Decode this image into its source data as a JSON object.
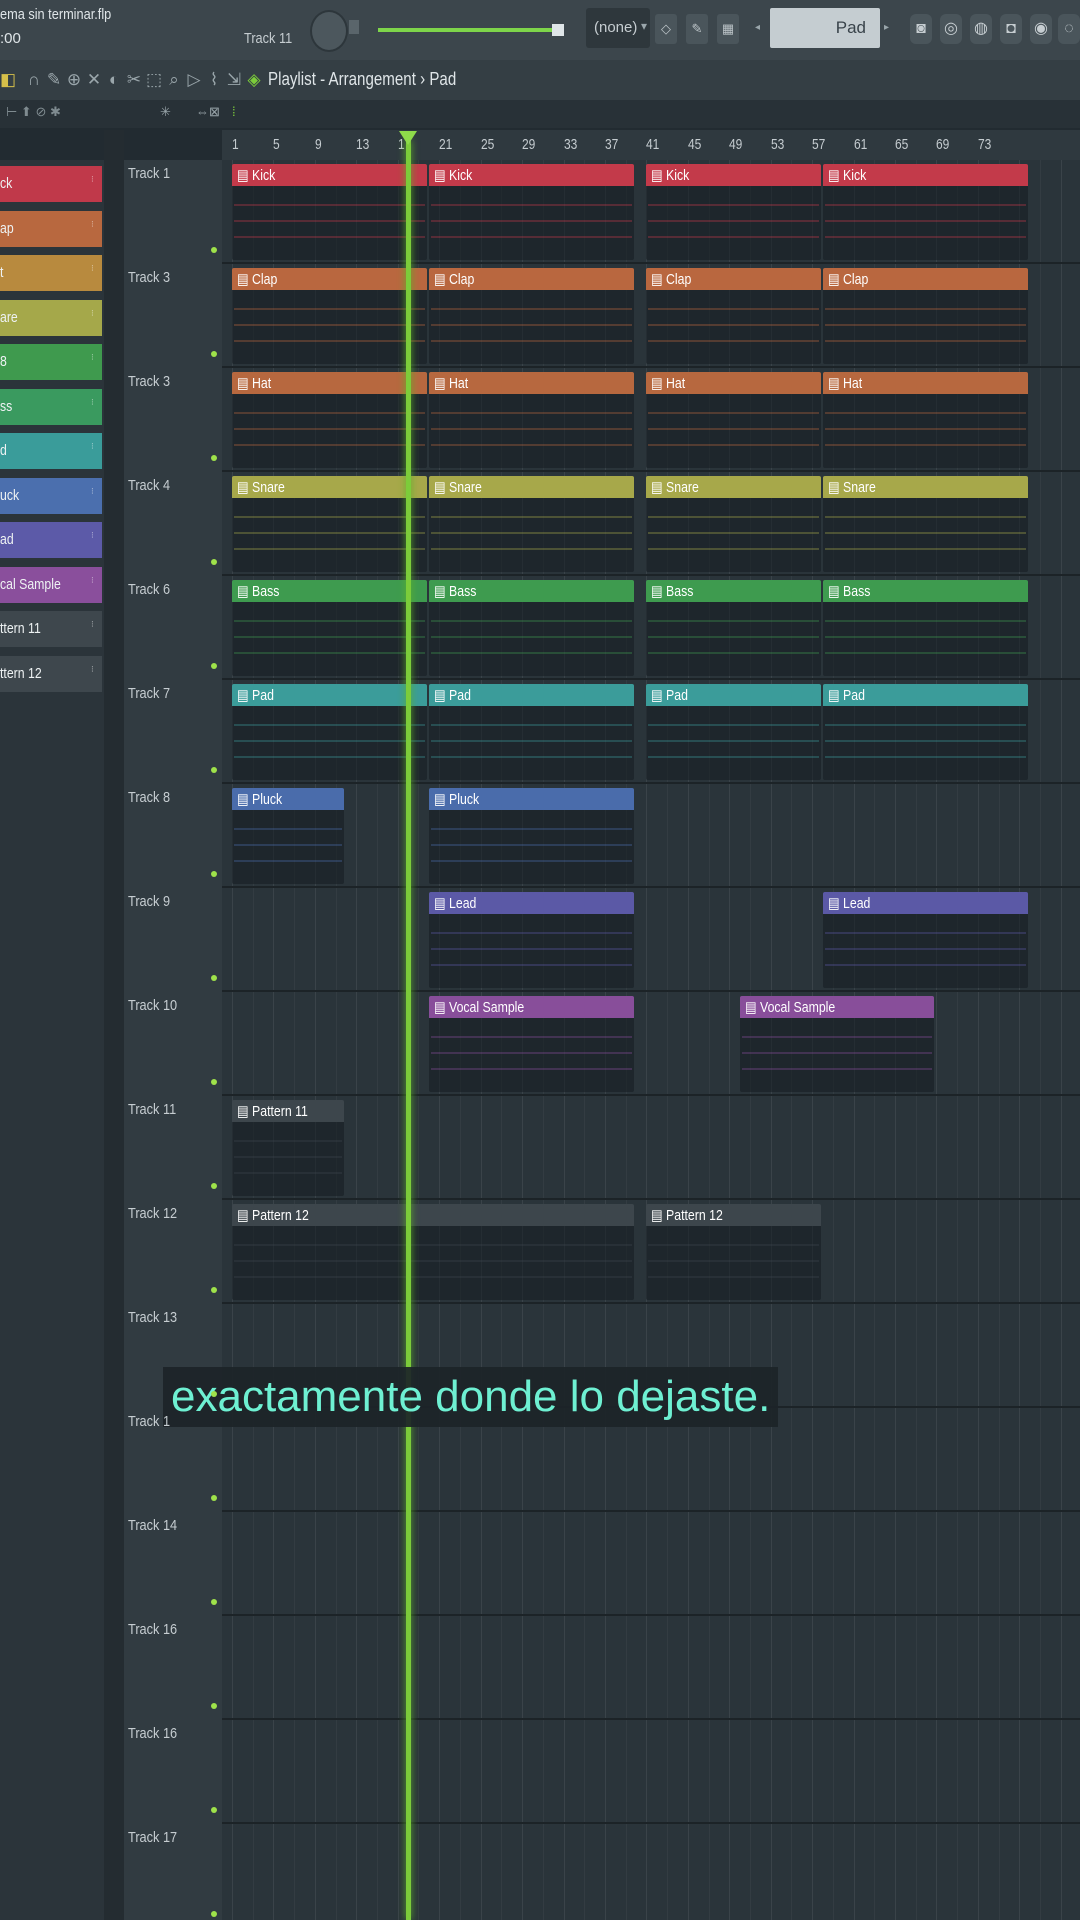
{
  "project": {
    "filename": "ema sin terminar.flp",
    "time": ":00"
  },
  "top_bar": {
    "track_selector": "Track 11",
    "pattern_selector": "(none)",
    "channel_display": "Pad"
  },
  "window": {
    "title": "Playlist - Arrangement › Pad"
  },
  "ruler": {
    "bars": [
      "1",
      "5",
      "9",
      "13",
      "17",
      "21",
      "25",
      "29",
      "33",
      "37",
      "41",
      "45",
      "49",
      "53",
      "57",
      "61",
      "65",
      "69",
      "73"
    ]
  },
  "pattern_list": [
    {
      "label": "ck",
      "color": "#c0394a"
    },
    {
      "label": "ap",
      "color": "#b8683f"
    },
    {
      "label": "t",
      "color": "#b88a3e"
    },
    {
      "label": "are",
      "color": "#a5a84a"
    },
    {
      "label": "8",
      "color": "#3f9a4e"
    },
    {
      "label": "ss",
      "color": "#3a9a5f"
    },
    {
      "label": "d",
      "color": "#3a9c9a"
    },
    {
      "label": "uck",
      "color": "#4b6fae"
    },
    {
      "label": "ad",
      "color": "#5c5aa8"
    },
    {
      "label": "cal Sample",
      "color": "#8a4f9c"
    },
    {
      "label": "ttern 11",
      "color": "#3e474d"
    },
    {
      "label": "ttern 12",
      "color": "#3e474d"
    }
  ],
  "tracks": [
    "Track 1",
    "Track 3",
    "Track 3",
    "Track 4",
    "Track 6",
    "Track 7",
    "Track 8",
    "Track 9",
    "Track 10",
    "Track 11",
    "Track 12",
    "Track 13",
    "Track 1",
    "Track 14",
    "Track 16",
    "Track 16",
    "Track 17"
  ],
  "clips": [
    {
      "track": 0,
      "start": 1,
      "end": 20,
      "name": "Kick",
      "color": "#c33a4a"
    },
    {
      "track": 0,
      "start": 20,
      "end": 40,
      "name": "Kick",
      "color": "#c33a4a"
    },
    {
      "track": 0,
      "start": 41,
      "end": 58,
      "name": "Kick",
      "color": "#c33a4a"
    },
    {
      "track": 0,
      "start": 58,
      "end": 78,
      "name": "Kick",
      "color": "#c33a4a"
    },
    {
      "track": 1,
      "start": 1,
      "end": 20,
      "name": "Clap",
      "color": "#b9673f"
    },
    {
      "track": 1,
      "start": 20,
      "end": 40,
      "name": "Clap",
      "color": "#b9673f"
    },
    {
      "track": 1,
      "start": 41,
      "end": 58,
      "name": "Clap",
      "color": "#b9673f"
    },
    {
      "track": 1,
      "start": 58,
      "end": 78,
      "name": "Clap",
      "color": "#b9673f"
    },
    {
      "track": 2,
      "start": 1,
      "end": 20,
      "name": "Hat",
      "color": "#b7683f"
    },
    {
      "track": 2,
      "start": 20,
      "end": 40,
      "name": "Hat",
      "color": "#b7683f"
    },
    {
      "track": 2,
      "start": 41,
      "end": 58,
      "name": "Hat",
      "color": "#b7683f"
    },
    {
      "track": 2,
      "start": 58,
      "end": 78,
      "name": "Hat",
      "color": "#b7683f"
    },
    {
      "track": 3,
      "start": 1,
      "end": 20,
      "name": "Snare",
      "color": "#a7a84a"
    },
    {
      "track": 3,
      "start": 20,
      "end": 40,
      "name": "Snare",
      "color": "#a7a84a"
    },
    {
      "track": 3,
      "start": 41,
      "end": 58,
      "name": "Snare",
      "color": "#a7a84a"
    },
    {
      "track": 3,
      "start": 58,
      "end": 78,
      "name": "Snare",
      "color": "#a7a84a"
    },
    {
      "track": 4,
      "start": 1,
      "end": 20,
      "name": "Bass",
      "color": "#3e9b4f"
    },
    {
      "track": 4,
      "start": 20,
      "end": 40,
      "name": "Bass",
      "color": "#3e9b4f"
    },
    {
      "track": 4,
      "start": 41,
      "end": 58,
      "name": "Bass",
      "color": "#3e9b4f"
    },
    {
      "track": 4,
      "start": 58,
      "end": 78,
      "name": "Bass",
      "color": "#3e9b4f"
    },
    {
      "track": 5,
      "start": 1,
      "end": 20,
      "name": "Pad",
      "color": "#3b9c9a"
    },
    {
      "track": 5,
      "start": 20,
      "end": 40,
      "name": "Pad",
      "color": "#3b9c9a"
    },
    {
      "track": 5,
      "start": 41,
      "end": 58,
      "name": "Pad",
      "color": "#3b9c9a"
    },
    {
      "track": 5,
      "start": 58,
      "end": 78,
      "name": "Pad",
      "color": "#3b9c9a"
    },
    {
      "track": 6,
      "start": 1,
      "end": 12,
      "name": "Pluck",
      "color": "#4a6cab"
    },
    {
      "track": 6,
      "start": 20,
      "end": 40,
      "name": "Pluck",
      "color": "#4a6cab"
    },
    {
      "track": 7,
      "start": 20,
      "end": 40,
      "name": "Lead",
      "color": "#5b59a6"
    },
    {
      "track": 7,
      "start": 58,
      "end": 78,
      "name": "Lead",
      "color": "#5b59a6"
    },
    {
      "track": 8,
      "start": 20,
      "end": 40,
      "name": "Vocal Sample",
      "color": "#884e9a"
    },
    {
      "track": 8,
      "start": 50,
      "end": 69,
      "name": "Vocal Sample",
      "color": "#884e9a"
    },
    {
      "track": 9,
      "start": 1,
      "end": 12,
      "name": "Pattern 11",
      "color": "#3d464c"
    },
    {
      "track": 10,
      "start": 1,
      "end": 40,
      "name": "Pattern 12",
      "color": "#3d464c"
    },
    {
      "track": 10,
      "start": 41,
      "end": 58,
      "name": "Pattern 12",
      "color": "#3d464c"
    }
  ],
  "playhead_bar": 18,
  "subtitle": "exactamente donde lo dejaste."
}
